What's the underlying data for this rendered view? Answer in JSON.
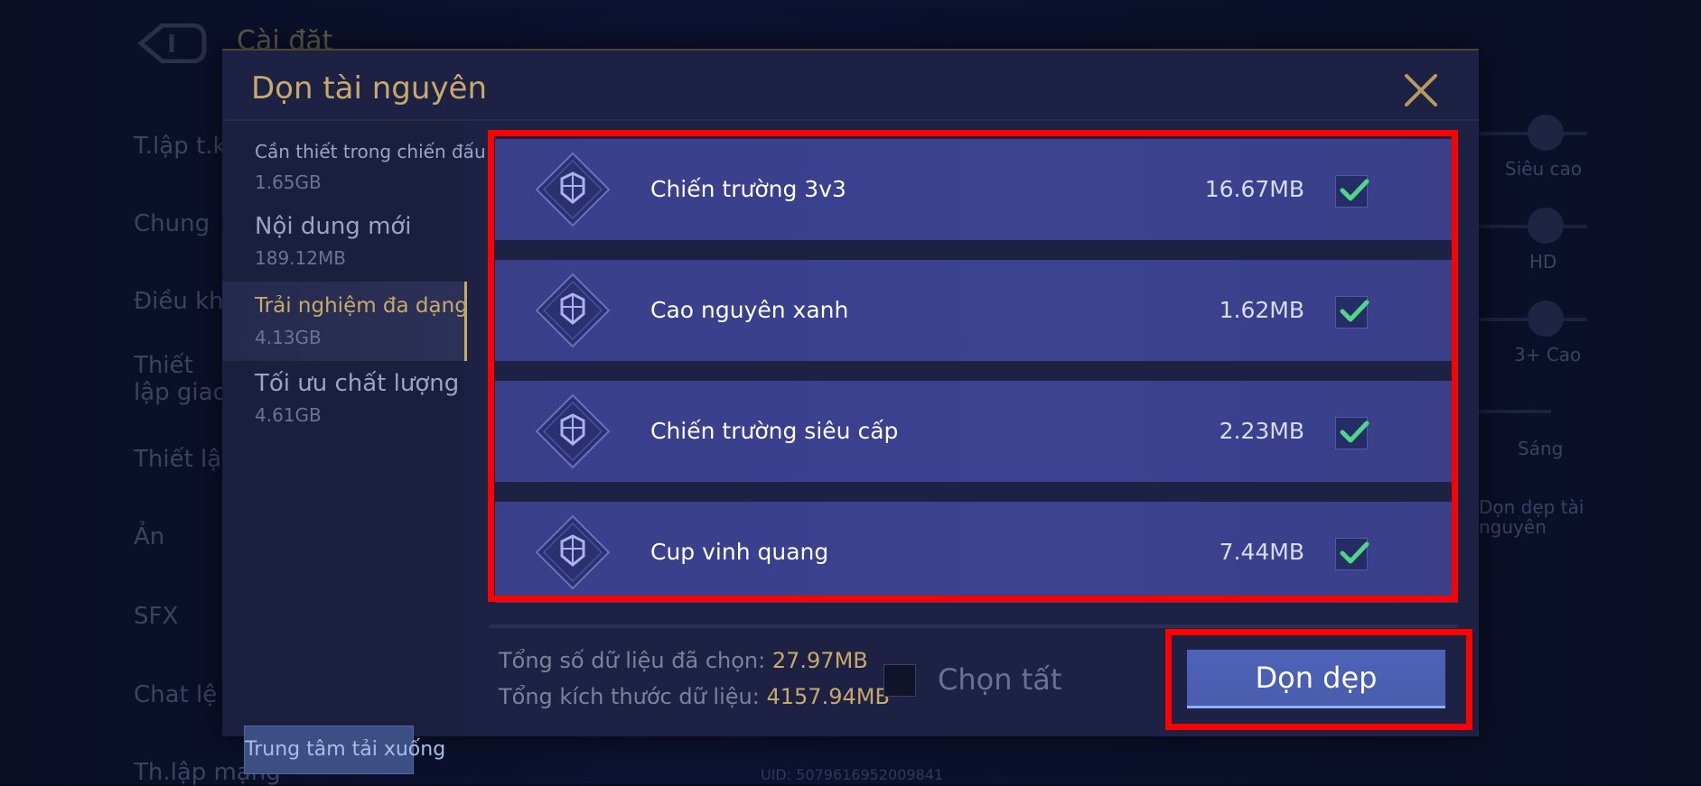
{
  "background": {
    "title": "Cài đặt",
    "nav_items": [
      "T.lập t.kế",
      "Chung",
      "Điều khiển",
      "Thiết lập giao diện",
      "Thiết lập",
      "Ản",
      "SFX",
      "Chat lệ",
      "Th.lập mạng"
    ],
    "right_labels": [
      "Siêu cao",
      "HD",
      "3+ Cao",
      "Sáng",
      "Dọn dẹp tài nguyên"
    ],
    "uid": "UID: 5079616952009841"
  },
  "modal": {
    "title": "Dọn tài nguyên",
    "categories": [
      {
        "name": "Cần thiết trong chiến đấu",
        "size": "1.65GB",
        "active": false
      },
      {
        "name": "Nội dung mới",
        "size": "189.12MB",
        "active": false
      },
      {
        "name": "Trải nghiệm đa dạng",
        "size": "4.13GB",
        "active": true
      },
      {
        "name": "Tối ưu chất lượng",
        "size": "4.61GB",
        "active": false
      }
    ],
    "download_center_label": "Trung tâm tải xuống",
    "resources": [
      {
        "name": "Chiến trường 3v3",
        "size": "16.67MB",
        "checked": true
      },
      {
        "name": "Cao nguyên xanh",
        "size": "1.62MB",
        "checked": true
      },
      {
        "name": "Chiến trường siêu cấp",
        "size": "2.23MB",
        "checked": true
      },
      {
        "name": "Cup vinh quang",
        "size": "7.44MB",
        "checked": true
      }
    ],
    "footer": {
      "selected_label": "Tổng số dữ liệu đã chọn:",
      "selected_value": "27.97MB",
      "total_label": "Tổng kích thước dữ liệu:",
      "total_value": "4157.94MB",
      "select_all_label": "Chọn tất",
      "select_all_checked": false,
      "clean_button_label": "Dọn dẹp"
    }
  },
  "colors": {
    "accent_gold": "#c9a96a",
    "check_green": "#4fd687",
    "highlight_red": "#ff0000",
    "button_blue": "#4d63b8"
  }
}
